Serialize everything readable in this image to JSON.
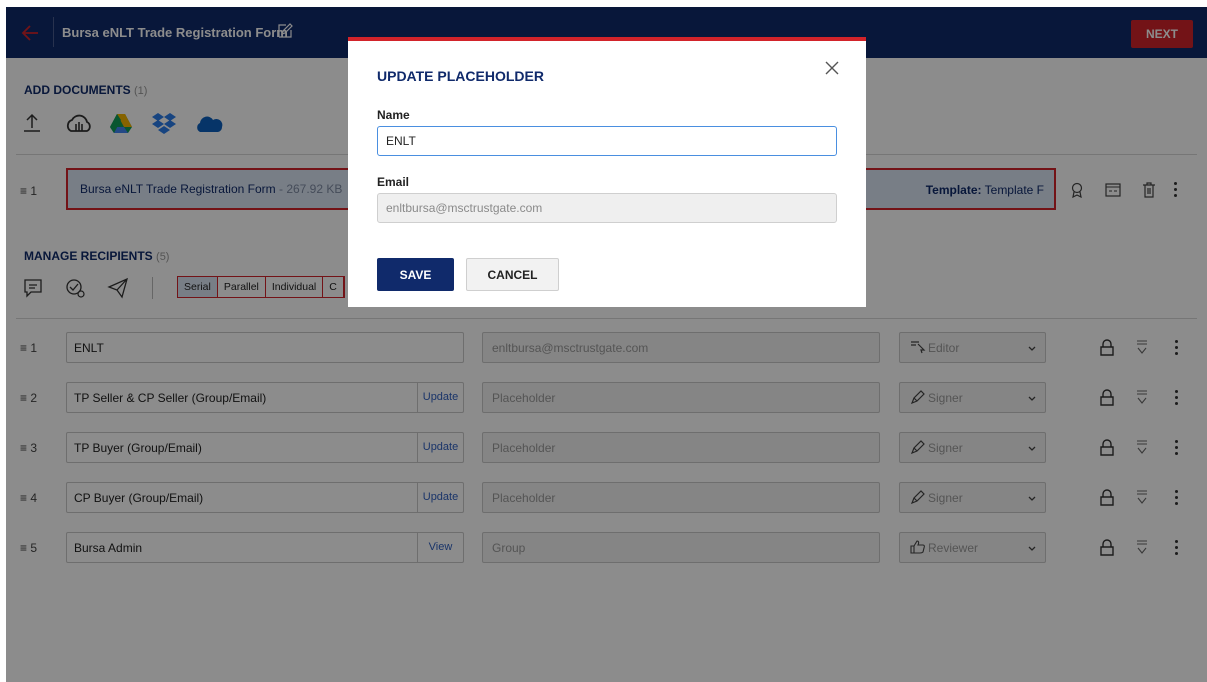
{
  "header": {
    "title": "Bursa eNLT Trade Registration Form",
    "next_label": "NEXT"
  },
  "documents": {
    "title": "ADD DOCUMENTS",
    "count": "(1)",
    "items": [
      {
        "index": "1",
        "name": "Bursa eNLT Trade Registration Form",
        "size": "- 267.92 KB",
        "template_label": "Template:",
        "template_value": "Template F"
      }
    ]
  },
  "recipients": {
    "title": "MANAGE RECIPIENTS",
    "count": "(5)",
    "modes": [
      "Serial",
      "Parallel",
      "Individual",
      "C"
    ],
    "rows": [
      {
        "index": "1",
        "name": "ENLT",
        "action": "",
        "email": "enltbursa@msctrustgate.com",
        "role": "Editor",
        "role_icon": "cursor-icon"
      },
      {
        "index": "2",
        "name": "TP Seller & CP Seller (Group/Email)",
        "action": "Update",
        "email": "Placeholder",
        "role": "Signer",
        "role_icon": "pen-icon"
      },
      {
        "index": "3",
        "name": "TP Buyer (Group/Email)",
        "action": "Update",
        "email": "Placeholder",
        "role": "Signer",
        "role_icon": "pen-icon"
      },
      {
        "index": "4",
        "name": "CP Buyer (Group/Email)",
        "action": "Update",
        "email": "Placeholder",
        "role": "Signer",
        "role_icon": "pen-icon"
      },
      {
        "index": "5",
        "name": "Bursa Admin",
        "action": "View",
        "email": "Group",
        "role": "Reviewer",
        "role_icon": "thumbs-up-icon"
      }
    ]
  },
  "modal": {
    "title": "UPDATE PLACEHOLDER",
    "name_label": "Name",
    "name_value": "ENLT",
    "email_label": "Email",
    "email_value": "enltbursa@msctrustgate.com",
    "save_label": "SAVE",
    "cancel_label": "CANCEL"
  },
  "colors": {
    "navy": "#102a6b",
    "accent": "#d2232a",
    "selected": "#dbe6f5"
  }
}
